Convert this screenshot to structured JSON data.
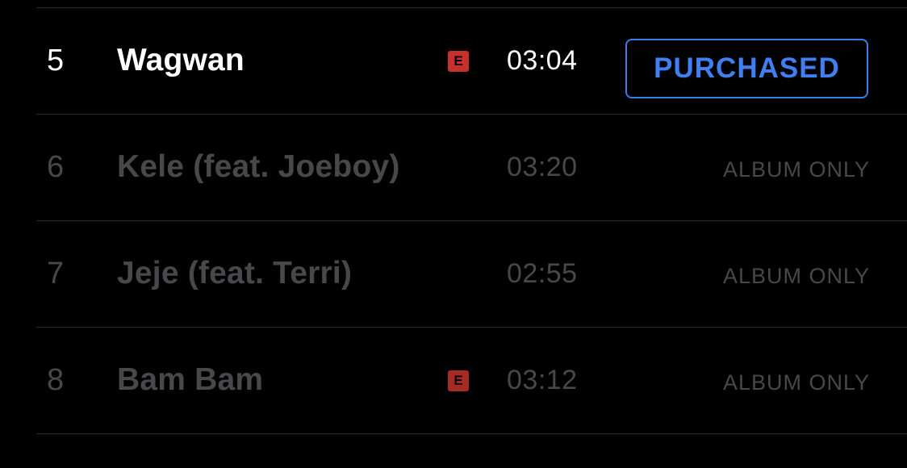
{
  "colors": {
    "background": "#000000",
    "active_text": "#ffffff",
    "dim_text": "#48484a",
    "accent_blue": "#3f7ff2",
    "explicit_badge": "#c7302b",
    "divider": "#2b2b2d"
  },
  "tracks": [
    {
      "number": "5",
      "title": "Wagwan",
      "explicit": true,
      "explicit_label": "E",
      "duration": "03:04",
      "status": "PURCHASED",
      "active": true
    },
    {
      "number": "6",
      "title": "Kele (feat. Joeboy)",
      "explicit": false,
      "duration": "03:20",
      "status": "ALBUM ONLY",
      "active": false
    },
    {
      "number": "7",
      "title": "Jeje (feat. Terri)",
      "explicit": false,
      "duration": "02:55",
      "status": "ALBUM ONLY",
      "active": false
    },
    {
      "number": "8",
      "title": "Bam Bam",
      "explicit": true,
      "explicit_label": "E",
      "duration": "03:12",
      "status": "ALBUM ONLY",
      "active": false
    }
  ]
}
